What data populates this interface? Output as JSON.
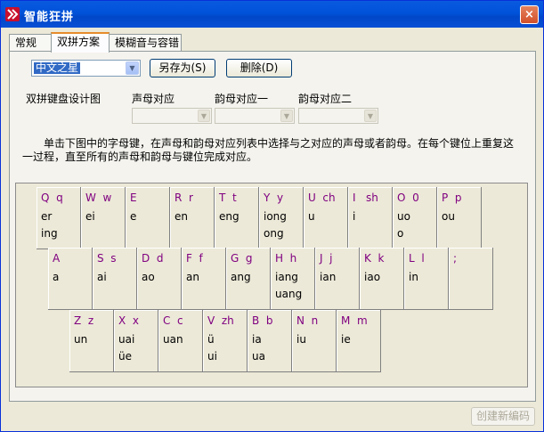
{
  "window": {
    "title": "智能狂拼",
    "close_label": "×"
  },
  "tabs": [
    {
      "label": "常规"
    },
    {
      "label": "双拼方案"
    },
    {
      "label": "模糊音与容错"
    }
  ],
  "scheme": {
    "selected": "中文之星",
    "save_as_label": "另存为(S)",
    "delete_label": "删除(D)"
  },
  "design": {
    "title": "双拼键盘设计图",
    "initial_label": "声母对应",
    "final1_label": "韵母对应一",
    "final2_label": "韵母对应二"
  },
  "instructions": "　　单击下图中的字母键，在声母和韵母对应列表中选择与之对应的声母或者韵母。在每个键位上重复这一过程，直至所有的声母和韵母与键位完成对应。",
  "keyboard": {
    "rows": [
      [
        {
          "label": "Q  q",
          "finals": "er\ning"
        },
        {
          "label": "W  w",
          "finals": "ei"
        },
        {
          "label": "E",
          "finals": "e"
        },
        {
          "label": "R  r",
          "finals": "en"
        },
        {
          "label": "T  t",
          "finals": "eng"
        },
        {
          "label": "Y  y",
          "finals": "iong\nong"
        },
        {
          "label": "U  ch",
          "finals": "u"
        },
        {
          "label": "I   sh",
          "finals": "i"
        },
        {
          "label": "O  0",
          "finals": "uo\no"
        },
        {
          "label": "P  p",
          "finals": "ou"
        }
      ],
      [
        {
          "label": "A",
          "finals": "a"
        },
        {
          "label": "S  s",
          "finals": "ai"
        },
        {
          "label": "D  d",
          "finals": "ao"
        },
        {
          "label": "F  f",
          "finals": "an"
        },
        {
          "label": "G  g",
          "finals": "ang"
        },
        {
          "label": "H  h",
          "finals": "iang\nuang"
        },
        {
          "label": "J  j",
          "finals": "ian"
        },
        {
          "label": "K  k",
          "finals": "iao"
        },
        {
          "label": "L  l",
          "finals": "in"
        },
        {
          "label": ";",
          "finals": ""
        }
      ],
      [
        {
          "label": "Z  z",
          "finals": "un"
        },
        {
          "label": "X  x",
          "finals": "uai\nüe"
        },
        {
          "label": "C  c",
          "finals": "uan"
        },
        {
          "label": "V  zh",
          "finals": "ü\nui"
        },
        {
          "label": "B  b",
          "finals": "ia\nua"
        },
        {
          "label": "N  n",
          "finals": "iu"
        },
        {
          "label": "M  m",
          "finals": "ie"
        }
      ]
    ]
  },
  "footer": {
    "create_label": "创建新编码"
  }
}
